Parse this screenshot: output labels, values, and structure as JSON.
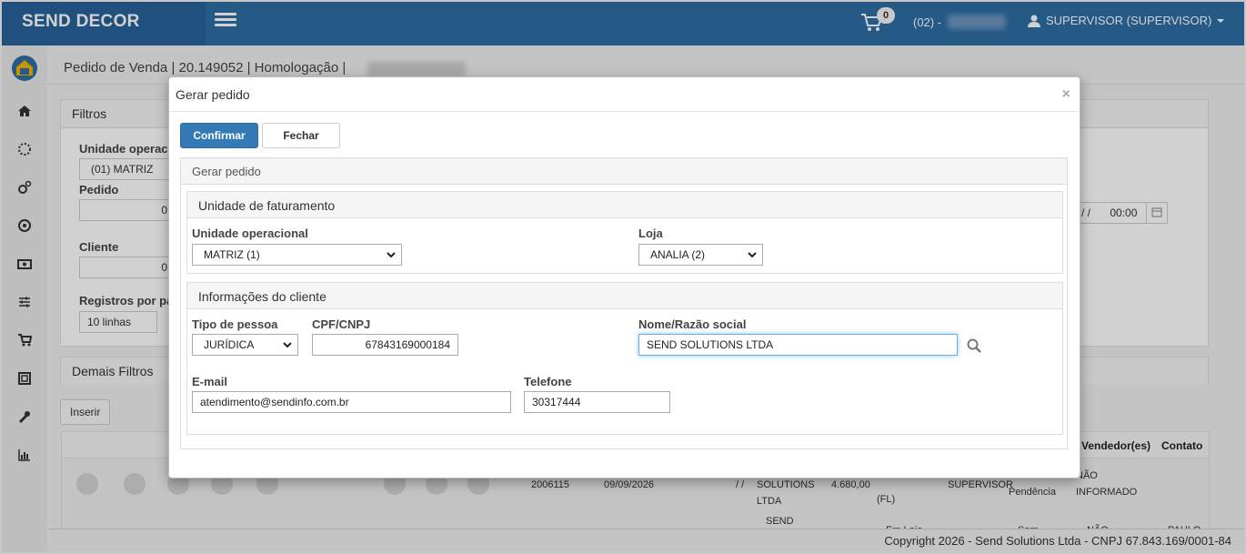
{
  "app": {
    "brand": "SEND DECOR",
    "cart_count": "0",
    "phone": "(02) -",
    "user": "SUPERVISOR (SUPERVISOR)"
  },
  "page": {
    "title": "Pedido de Venda | 20.149052 | Homologação |"
  },
  "filters": {
    "title": "Filtros",
    "unidade_label": "Unidade operac",
    "unidade_value": "(01) MATRIZ",
    "pedido_label": "Pedido",
    "pedido_value": "0",
    "cliente_label": "Cliente",
    "cliente_value": "0",
    "registros_label": "Registros por pá",
    "registros_value": "10 linhas",
    "date_tail": "/ /",
    "time_value": "00:00"
  },
  "demais": {
    "title": "Demais Filtros"
  },
  "inserir_label": "Inserir",
  "table": {
    "headers": [
      "Vendedor(es)",
      "Contato"
    ],
    "row1": {
      "num": "2006115",
      "date": "09/09/2026",
      "slash": "/ /",
      "client_lines": [
        "SOLUTIONS",
        "LTDA"
      ],
      "value": "4.680,00",
      "fl": "(FL)",
      "vendedor": "SUPERVISOR",
      "status": "Pendência",
      "contato_lines": [
        "NÃO",
        "INFORMADO"
      ]
    },
    "row2": {
      "client": "SEND",
      "status_a": "Em Loja",
      "status_b": "Sem",
      "contato": "NÃO",
      "extra": "PAULO"
    }
  },
  "footer": "Copyright 2026 - Send Solutions Ltda - CNPJ 67.843.169/0001-84",
  "modal": {
    "title": "Gerar pedido",
    "confirm": "Confirmar",
    "close": "Fechar",
    "section": "Gerar pedido",
    "faturamento": {
      "title": "Unidade de faturamento",
      "unidade_label": "Unidade operacional",
      "unidade_value": "MATRIZ (1)",
      "loja_label": "Loja",
      "loja_value": "ANALIA (2)"
    },
    "cliente": {
      "title": "Informações do cliente",
      "tipo_label": "Tipo de pessoa",
      "tipo_value": "JURÍDICA",
      "cpf_label": "CPF/CNPJ",
      "cpf_value": "67843169000184",
      "nome_label": "Nome/Razão social",
      "nome_value": "SEND SOLUTIONS LTDA",
      "email_label": "E-mail",
      "email_value": "atendimento@sendinfo.com.br",
      "telefone_label": "Telefone",
      "telefone_value": "30317444"
    }
  }
}
